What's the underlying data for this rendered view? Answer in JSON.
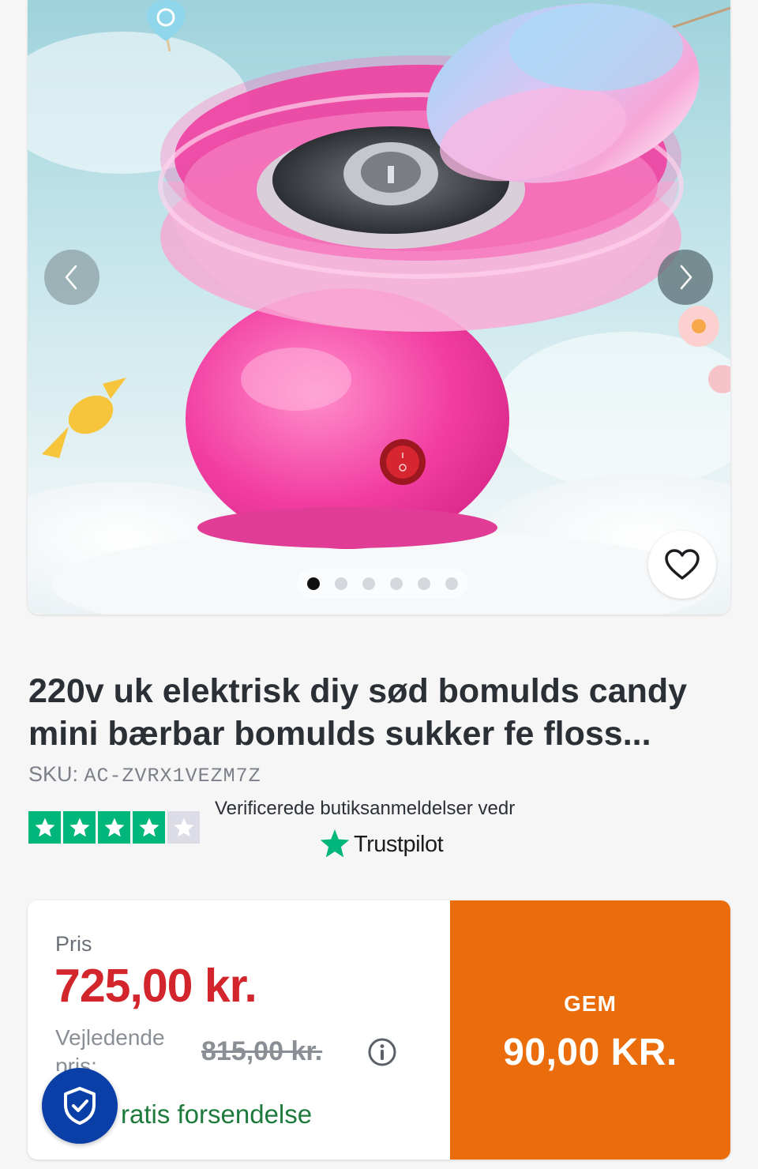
{
  "gallery": {
    "image_alt": "Pink cotton candy machine",
    "slide_count": 6,
    "active_slide": 1
  },
  "product": {
    "title": "220v uk elektrisk diy sød bomulds candy mini bærbar bomulds sukker fe floss...",
    "sku_label": "SKU:",
    "sku_value": "AC-ZVRX1VEZM7Z"
  },
  "trustpilot": {
    "rating_stars": 4,
    "max_stars": 5,
    "text": "Verificerede butiksanmeldelser vedr",
    "brand": "Trustpilot",
    "brand_color": "#00b67a"
  },
  "pricing": {
    "price_label": "Pris",
    "price_value": "725,00 kr.",
    "rrp_label": "Vejledende pris:",
    "rrp_value": "815,00 kr.",
    "shipping_text": "ratis forsendelse",
    "save_label": "GEM",
    "save_value": "90,00 KR.",
    "save_bg_color": "#ea6c0a",
    "price_color": "#d3262c"
  },
  "icons": {
    "prev": "chevron-left-icon",
    "next": "chevron-right-icon",
    "wishlist": "heart-icon",
    "info": "info-icon",
    "badge": "shield-check-icon"
  }
}
